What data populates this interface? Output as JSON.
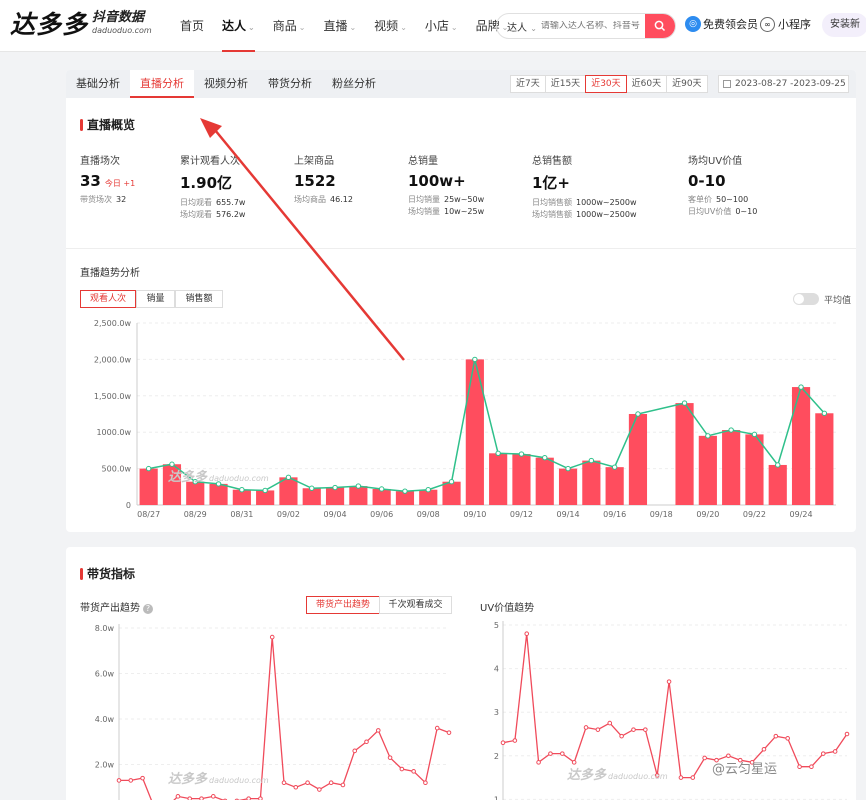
{
  "header": {
    "logo_main": "达多多",
    "logo_cn": "抖音数据",
    "logo_en": "daduoduo.com",
    "nav": [
      {
        "label": "首页",
        "caret": false,
        "active": false
      },
      {
        "label": "达人",
        "caret": true,
        "active": true
      },
      {
        "label": "商品",
        "caret": true,
        "active": false
      },
      {
        "label": "直播",
        "caret": true,
        "active": false
      },
      {
        "label": "视频",
        "caret": true,
        "active": false
      },
      {
        "label": "小店",
        "caret": true,
        "active": false
      },
      {
        "label": "品牌",
        "caret": true,
        "active": false
      }
    ],
    "search_type": "达人",
    "search_placeholder": "请输入达人名称、抖音号",
    "vip_label": "免费领会员",
    "mini_program_label": "小程序",
    "download_label": "安装新"
  },
  "tabs": [
    "基础分析",
    "直播分析",
    "视频分析",
    "带货分析",
    "粉丝分析"
  ],
  "active_tab": "直播分析",
  "ranges": [
    "近7天",
    "近15天",
    "近30天",
    "近60天",
    "近90天"
  ],
  "active_range": "近30天",
  "date_range": "2023-08-27  -2023-09-25",
  "overview": {
    "title": "直播概览",
    "metrics": [
      {
        "label": "直播场次",
        "value": "33",
        "today": "今日 +1",
        "subs": [
          {
            "k": "带货场次",
            "v": "32"
          }
        ]
      },
      {
        "label": "累计观看人次",
        "value": "1.90亿",
        "subs": [
          {
            "k": "日均观看",
            "v": "655.7w"
          },
          {
            "k": "场均观看",
            "v": "576.2w"
          }
        ]
      },
      {
        "label": "上架商品",
        "value": "1522",
        "subs": [
          {
            "k": "场均商品",
            "v": "46.12"
          }
        ]
      },
      {
        "label": "总销量",
        "value": "100w+",
        "subs": [
          {
            "k": "日均销量",
            "v": "25w~50w"
          },
          {
            "k": "场均销量",
            "v": "10w~25w"
          }
        ]
      },
      {
        "label": "总销售额",
        "value": "1亿+",
        "subs": [
          {
            "k": "日均销售额",
            "v": "1000w~2500w"
          },
          {
            "k": "场均销售额",
            "v": "1000w~2500w"
          }
        ]
      },
      {
        "label": "场均UV价值",
        "value": "0-10",
        "subs": [
          {
            "k": "客单价",
            "v": "50~100"
          },
          {
            "k": "日均UV价值",
            "v": "0~10"
          }
        ]
      }
    ]
  },
  "trend": {
    "title": "直播趋势分析",
    "segments": [
      "观看人次",
      "销量",
      "销售额"
    ],
    "active_segment": "观看人次",
    "toggle_label": "平均值"
  },
  "sales": {
    "title": "带货指标",
    "left_title": "带货产出趋势",
    "left_segments": [
      "带货产出趋势",
      "千次观看成交"
    ],
    "left_active": "带货产出趋势",
    "right_title": "UV价值趋势"
  },
  "watermark": {
    "main": "达多多",
    "sub": "daduoduo.com",
    "corner": "@云匀星运"
  },
  "colors": {
    "accent": "#e53935",
    "bar": "#ff4d5e",
    "line": "#2fc08b"
  },
  "chart_data": [
    {
      "type": "bar",
      "title": "",
      "categories": [
        "08/27",
        "08/28",
        "08/29",
        "08/30",
        "08/31",
        "09/01",
        "09/02",
        "09/03",
        "09/04",
        "09/05",
        "09/06",
        "09/07",
        "09/08",
        "09/09",
        "09/10",
        "09/11",
        "09/12",
        "09/13",
        "09/14",
        "09/15",
        "09/16",
        "09/17",
        "09/18",
        "09/19",
        "09/20",
        "09/21",
        "09/22",
        "09/23",
        "09/24",
        "09/25"
      ],
      "x_tick_labels": [
        "08/27",
        "08/29",
        "08/31",
        "09/02",
        "09/04",
        "09/06",
        "09/08",
        "09/10",
        "09/12",
        "09/14",
        "09/16",
        "09/18",
        "09/20",
        "09/22",
        "09/24"
      ],
      "values": [
        500,
        560,
        320,
        290,
        210,
        200,
        380,
        230,
        240,
        260,
        220,
        190,
        210,
        320,
        2000,
        710,
        700,
        650,
        500,
        610,
        520,
        1250,
        0,
        1400,
        950,
        1030,
        970,
        550,
        1620,
        1260
      ],
      "line_values": [
        500,
        560,
        320,
        290,
        210,
        200,
        380,
        230,
        240,
        260,
        220,
        190,
        210,
        320,
        2000,
        710,
        700,
        650,
        500,
        610,
        520,
        1250,
        null,
        1400,
        950,
        1030,
        970,
        550,
        1620,
        1260
      ],
      "y_ticks": [
        "0",
        "500.0w",
        "1000.0w",
        "1,500.0w",
        "2,000.0w",
        "2,500.0w"
      ],
      "ylim": [
        0,
        2500
      ],
      "unit": "w"
    },
    {
      "type": "line",
      "title": "带货产出趋势",
      "values": [
        1.3,
        1.3,
        1.4,
        0.1,
        0.1,
        0.6,
        0.5,
        0.5,
        0.6,
        0.4,
        0.4,
        0.5,
        0.5,
        7.6,
        1.2,
        1.0,
        1.2,
        0.9,
        1.2,
        1.1,
        2.6,
        3.0,
        3.5,
        2.3,
        1.8,
        1.7,
        1.2,
        3.6,
        3.4
      ],
      "y_ticks": [
        "2.0w",
        "4.0w",
        "6.0w",
        "8.0w"
      ],
      "ylim": [
        0,
        8
      ],
      "unit": "w"
    },
    {
      "type": "line",
      "title": "UV价值趋势",
      "values": [
        2.3,
        2.35,
        4.8,
        1.85,
        2.05,
        2.05,
        1.85,
        2.65,
        2.6,
        2.75,
        2.45,
        2.6,
        2.6,
        1.55,
        3.7,
        1.5,
        1.5,
        1.95,
        1.9,
        2.0,
        1.9,
        1.85,
        2.15,
        2.45,
        2.4,
        1.75,
        1.75,
        2.05,
        2.1,
        2.5
      ],
      "y_ticks": [
        "1",
        "2",
        "3",
        "4",
        "5"
      ],
      "ylim": [
        0,
        5
      ]
    }
  ]
}
